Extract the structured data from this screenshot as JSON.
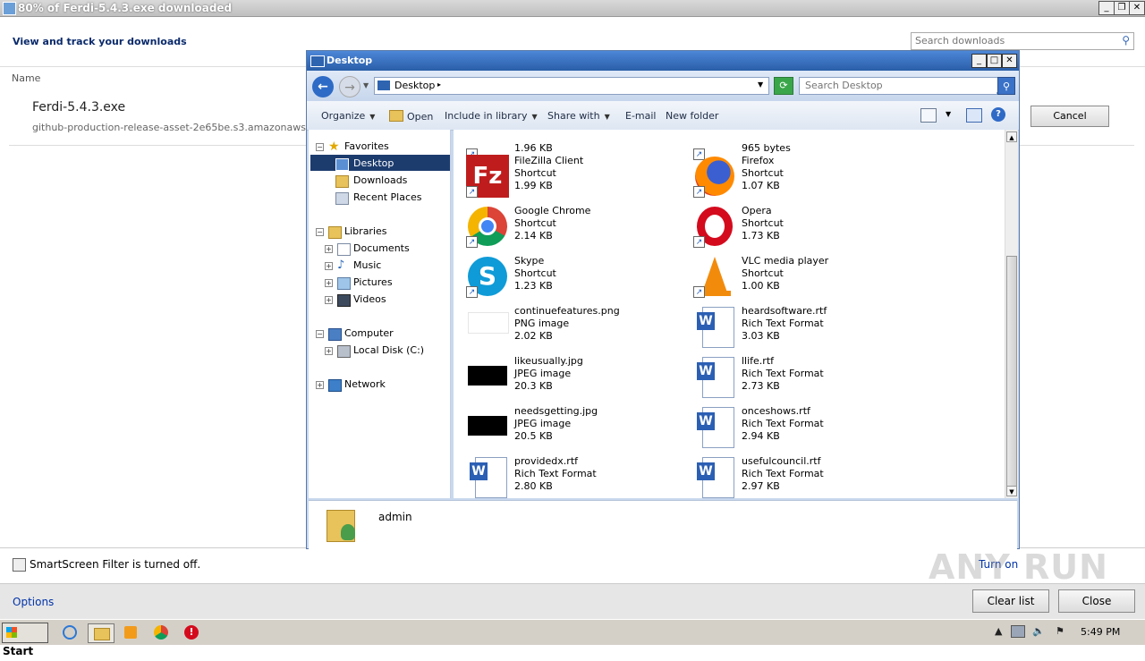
{
  "download_manager": {
    "title": "80% of Ferdi-5.4.3.exe downloaded",
    "header": "View and track your downloads",
    "search_placeholder": "Search downloads",
    "column_name": "Name",
    "file_name": "Ferdi-5.4.3.exe",
    "file_source": "github-production-release-asset-2e65be.s3.amazonaws.com",
    "cancel_label": "Cancel",
    "smartscreen_text": "SmartScreen Filter is turned off.",
    "turn_on_label": "Turn on",
    "options_label": "Options",
    "clear_list_label": "Clear list",
    "close_label": "Close"
  },
  "explorer": {
    "title": "Desktop",
    "address": "Desktop",
    "search_placeholder": "Search Desktop",
    "toolbar": {
      "organize": "Organize",
      "open": "Open",
      "include_in_library": "Include in library",
      "share_with": "Share with",
      "email": "E-mail",
      "new_folder": "New folder"
    },
    "nav": {
      "favorites": "Favorites",
      "desktop": "Desktop",
      "downloads": "Downloads",
      "recent_places": "Recent Places",
      "libraries": "Libraries",
      "documents": "Documents",
      "music": "Music",
      "pictures": "Pictures",
      "videos": "Videos",
      "computer": "Computer",
      "local_disk": "Local Disk (C:)",
      "network": "Network"
    },
    "files": [
      {
        "name": "",
        "type": "",
        "size": "1.96 KB",
        "icon": "partial-icon"
      },
      {
        "name": "",
        "type": "",
        "size": "965 bytes",
        "icon": "partial-icon"
      },
      {
        "name": "FileZilla Client",
        "type": "Shortcut",
        "size": "1.99 KB",
        "icon": "filezilla-icon"
      },
      {
        "name": "Firefox",
        "type": "Shortcut",
        "size": "1.07 KB",
        "icon": "firefox-icon"
      },
      {
        "name": "Google Chrome",
        "type": "Shortcut",
        "size": "2.14 KB",
        "icon": "chrome-icon"
      },
      {
        "name": "Opera",
        "type": "Shortcut",
        "size": "1.73 KB",
        "icon": "opera-icon"
      },
      {
        "name": "Skype",
        "type": "Shortcut",
        "size": "1.23 KB",
        "icon": "skype-icon"
      },
      {
        "name": "VLC media player",
        "type": "Shortcut",
        "size": "1.00 KB",
        "icon": "vlc-icon"
      },
      {
        "name": "continuefeatures.png",
        "type": "PNG image",
        "size": "2.02 KB",
        "icon": "png-thumbnail-icon"
      },
      {
        "name": "heardsoftware.rtf",
        "type": "Rich Text Format",
        "size": "3.03 KB",
        "icon": "word-document-icon"
      },
      {
        "name": "likeusually.jpg",
        "type": "JPEG image",
        "size": "20.3 KB",
        "icon": "jpg-thumbnail-icon"
      },
      {
        "name": "llife.rtf",
        "type": "Rich Text Format",
        "size": "2.73 KB",
        "icon": "word-document-icon"
      },
      {
        "name": "needsgetting.jpg",
        "type": "JPEG image",
        "size": "20.5 KB",
        "icon": "jpg-thumbnail-icon"
      },
      {
        "name": "onceshows.rtf",
        "type": "Rich Text Format",
        "size": "2.94 KB",
        "icon": "word-document-icon"
      },
      {
        "name": "providedx.rtf",
        "type": "Rich Text Format",
        "size": "2.80 KB",
        "icon": "word-document-icon"
      },
      {
        "name": "usefulcouncil.rtf",
        "type": "Rich Text Format",
        "size": "2.97 KB",
        "icon": "word-document-icon"
      }
    ],
    "details_name": "admin"
  },
  "taskbar": {
    "start_label": "Start",
    "clock": "5:49 PM"
  },
  "watermark": "ANY RUN"
}
